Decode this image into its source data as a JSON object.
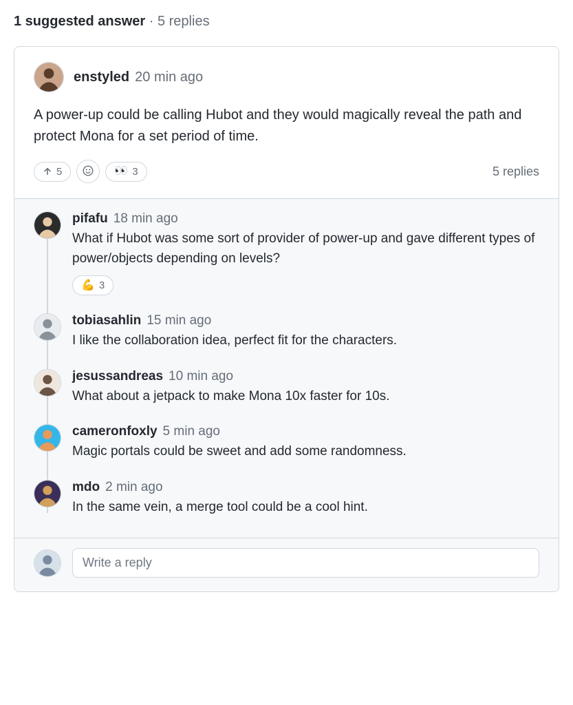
{
  "summary": {
    "suggested_answers_text": "1 suggested answer",
    "separator": " · ",
    "replies_text": "5 replies"
  },
  "answer": {
    "author": "enstyled",
    "time": "20 min ago",
    "body": "A power-up could be calling Hubot and they would magically reveal the path and protect Mona for a set period of time.",
    "reactions": {
      "upvote_count": "5",
      "eyes_emoji": "👀",
      "eyes_count": "3"
    },
    "reply_count_label": "5 replies"
  },
  "replies": [
    {
      "author": "pifafu",
      "time": "18 min ago",
      "text": "What if Hubot was some sort of provider of power-up and gave different types of power/objects depending on levels?",
      "reaction_emoji": "💪",
      "reaction_count": "3"
    },
    {
      "author": "tobiasahlin",
      "time": "15 min ago",
      "text": "I like the collaboration idea, perfect fit for the characters."
    },
    {
      "author": "jesussandreas",
      "time": "10 min ago",
      "text": "What about a jetpack to make Mona 10x faster for 10s."
    },
    {
      "author": "cameronfoxly",
      "time": "5 min ago",
      "text": "Magic portals could be sweet and add some randomness."
    },
    {
      "author": "mdo",
      "time": "2 min ago",
      "text": "In the same vein, a merge tool could be a cool hint."
    }
  ],
  "reply_input": {
    "placeholder": "Write a reply"
  },
  "avatar_colors": {
    "enstyled": {
      "bg": "#caa58b",
      "fg": "#5a3c2a"
    },
    "pifafu": {
      "bg": "#2b2b2b",
      "fg": "#e8c9a6"
    },
    "tobiasahlin": {
      "bg": "#e9ecef",
      "fg": "#8a9299"
    },
    "jesussandreas": {
      "bg": "#efe7dd",
      "fg": "#6b5545"
    },
    "cameronfoxly": {
      "bg": "#35b6e8",
      "fg": "#e89a5a"
    },
    "mdo": {
      "bg": "#3b2f5a",
      "fg": "#d1a05a"
    },
    "me": {
      "bg": "#d7e1ea",
      "fg": "#7a8aa0"
    }
  }
}
